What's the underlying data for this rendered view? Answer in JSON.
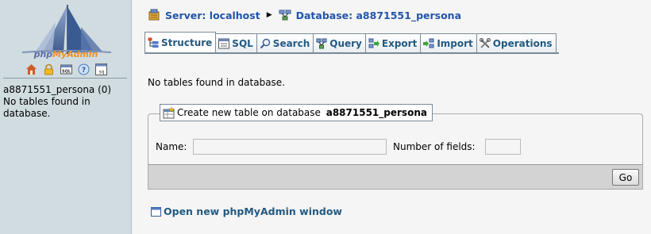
{
  "left": {
    "logo_parts": [
      "php",
      "My",
      "Admin"
    ],
    "icons": [
      "home-icon",
      "lock-icon",
      "sql-icon",
      "help-icon",
      "query-window-icon"
    ],
    "database_link": "a8871551_persona (0)",
    "no_tables": "No tables found in database."
  },
  "breadcrumb": {
    "server": "Server: localhost",
    "database": "Database: a8871551_persona",
    "server_icon": "server-icon",
    "database_icon": "database-icon"
  },
  "tabs": [
    {
      "label": "Structure",
      "icon": "structure-icon",
      "active": true
    },
    {
      "label": "SQL",
      "icon": "sql-icon",
      "active": false
    },
    {
      "label": "Search",
      "icon": "search-icon",
      "active": false
    },
    {
      "label": "Query",
      "icon": "query-icon",
      "active": false
    },
    {
      "label": "Export",
      "icon": "export-icon",
      "active": false
    },
    {
      "label": "Import",
      "icon": "import-icon",
      "active": false
    },
    {
      "label": "Operations",
      "icon": "operations-icon",
      "active": false
    }
  ],
  "main": {
    "no_tables": "No tables found in database.",
    "create_legend_prefix": "Create new table on database ",
    "create_legend_db": "a8871551_persona",
    "name_label": "Name:",
    "name_value": "",
    "fields_label": "Number of fields:",
    "fields_value": "",
    "go_label": "Go",
    "new_window_link": "Open new phpMyAdmin window"
  },
  "colors": {
    "left_bg": "#d0dce0",
    "link": "#235a81",
    "breadcrumb": "#2255aa",
    "accent_orange": "#f08e21"
  }
}
